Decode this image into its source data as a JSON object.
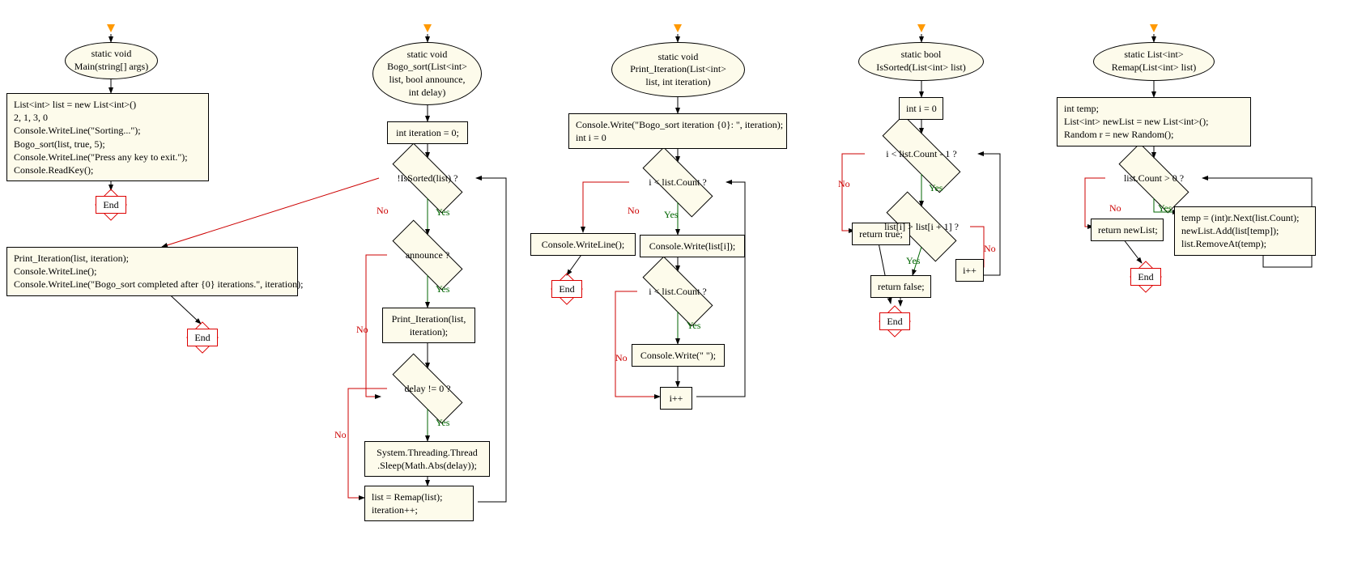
{
  "flowcharts": {
    "main": {
      "title": "static void\nMain(string[] args)",
      "rect1": "List<int> list = new List<int>()\n2, 1, 3, 0\nConsole.WriteLine(\"Sorting...\");\nBogo_sort(list, true, 5);\nConsole.WriteLine(\"Press any key to exit.\");\nConsole.ReadKey();",
      "end": "End"
    },
    "bogo_sort": {
      "title": "static void\nBogo_sort(List<int>\nlist, bool announce,\nint delay)",
      "rect1": "int iteration = 0;",
      "cond1": "!IsSorted(list) ?",
      "cond2": "announce ?",
      "rect2": "Print_Iteration(list,\niteration);",
      "cond3": "delay != 0 ?",
      "rect3": "System.Threading.Thread\n.Sleep(Math.Abs(delay));",
      "rect4": "list = Remap(list);\niteration++;",
      "rect_no": "Print_Iteration(list, iteration);\nConsole.WriteLine();\nConsole.WriteLine(\"Bogo_sort completed after {0} iterations.\", iteration);",
      "end": "End"
    },
    "print_iteration": {
      "title": "static void\nPrint_Iteration(List<int>\nlist, int iteration)",
      "rect1": "Console.Write(\"Bogo_sort iteration {0}: \", iteration);\nint i = 0",
      "cond1": "i < list.Count ?",
      "rect_no": "Console.WriteLine();",
      "rect_yes": "Console.Write(list[i]);",
      "cond2": "i < list.Count ?",
      "rect2": "Console.Write(\" \");",
      "rect3": "i++",
      "end": "End"
    },
    "is_sorted": {
      "title": "static bool\nIsSorted(List<int> list)",
      "rect1": "int i = 0",
      "cond1": "i < list.Count - 1 ?",
      "cond2": "list[i] > list[i + 1] ?",
      "rect_no_outer": "return true;",
      "rect_yes": "return false;",
      "rect_no_inner": "i++",
      "end": "End"
    },
    "remap": {
      "title": "static List<int>\nRemap(List<int> list)",
      "rect1": "int temp;\nList<int> newList = new List<int>();\nRandom r = new Random();",
      "cond1": "list.Count > 0 ?",
      "rect_no": "return newList;",
      "rect_yes": "temp = (int)r.Next(list.Count);\nnewList.Add(list[temp]);\nlist.RemoveAt(temp);",
      "end": "End"
    }
  },
  "labels": {
    "yes": "Yes",
    "no": "No"
  }
}
